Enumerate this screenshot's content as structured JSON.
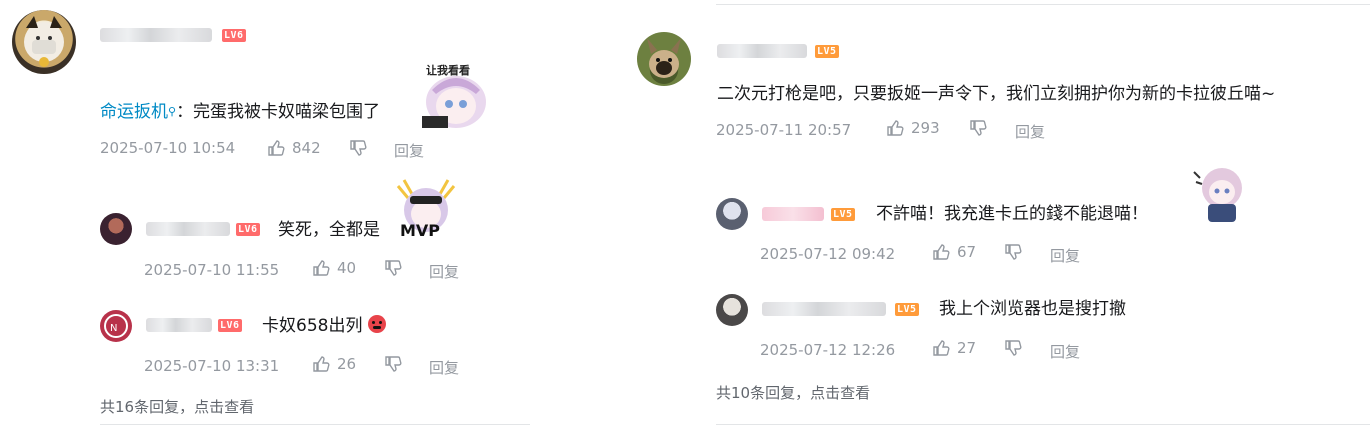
{
  "left": {
    "main": {
      "level": "LV6",
      "mention": "命运扳机",
      "text": "：完蛋我被卡奴喵梁包围了",
      "timestamp": "2025-07-10 10:54",
      "likes": "842",
      "reply_label": "回复"
    },
    "replies": [
      {
        "level": "LV6",
        "text": "笑死，全都是",
        "timestamp": "2025-07-10 11:55",
        "likes": "40",
        "reply_label": "回复"
      },
      {
        "level": "LV6",
        "text": "卡奴658出列",
        "timestamp": "2025-07-10 13:31",
        "likes": "26",
        "reply_label": "回复"
      }
    ],
    "summary": "共16条回复，点击查看"
  },
  "right": {
    "main": {
      "level": "LV5",
      "text": "二次元打枪是吧，只要扳姬一声令下，我们立刻拥护你为新的卡拉彼丘喵~",
      "timestamp": "2025-07-11 20:57",
      "likes": "293",
      "reply_label": "回复"
    },
    "replies": [
      {
        "level": "LV5",
        "text": "不許喵！我充進卡丘的錢不能退喵！",
        "timestamp": "2025-07-12 09:42",
        "likes": "67",
        "reply_label": "回复"
      },
      {
        "level": "LV5",
        "text": "我上个浏览器也是搜打撤",
        "timestamp": "2025-07-12 12:26",
        "likes": "27",
        "reply_label": "回复"
      }
    ],
    "summary": "共10条回复，点击查看"
  },
  "sticker_captions": {
    "main": "让我看看",
    "mvp": "MVP"
  },
  "colors": {
    "link": "#008ac5",
    "meta": "#9499a0",
    "lv6": "#ff6b6b",
    "lv5": "#ff9b3a"
  },
  "icons": [
    "like-icon",
    "dislike-icon",
    "search-icon",
    "angry-emoji-icon"
  ]
}
